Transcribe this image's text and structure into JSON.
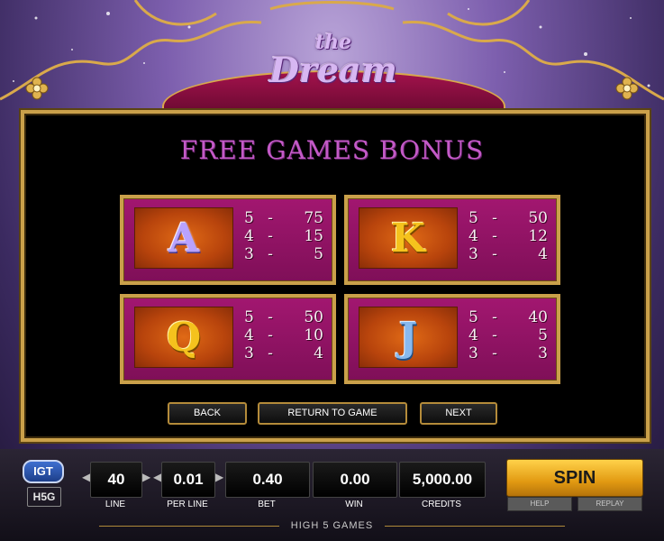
{
  "game": {
    "logo_small": "the",
    "logo_main": "Dream"
  },
  "bonus": {
    "title": "FREE GAMES BONUS",
    "symbols": [
      {
        "letter": "A",
        "color": "purple",
        "pays": [
          {
            "count": "5",
            "amount": "75"
          },
          {
            "count": "4",
            "amount": "15"
          },
          {
            "count": "3",
            "amount": "5"
          }
        ]
      },
      {
        "letter": "K",
        "color": "gold",
        "pays": [
          {
            "count": "5",
            "amount": "50"
          },
          {
            "count": "4",
            "amount": "12"
          },
          {
            "count": "3",
            "amount": "4"
          }
        ]
      },
      {
        "letter": "Q",
        "color": "gold",
        "pays": [
          {
            "count": "5",
            "amount": "50"
          },
          {
            "count": "4",
            "amount": "10"
          },
          {
            "count": "3",
            "amount": "4"
          }
        ]
      },
      {
        "letter": "J",
        "color": "blue",
        "pays": [
          {
            "count": "5",
            "amount": "40"
          },
          {
            "count": "4",
            "amount": "5"
          },
          {
            "count": "3",
            "amount": "3"
          }
        ]
      }
    ],
    "dash": "-"
  },
  "nav": {
    "back": "BACK",
    "return": "RETURN TO GAME",
    "next": "NEXT"
  },
  "meters": {
    "line": {
      "value": "40",
      "label": "LINE"
    },
    "per_line": {
      "value": "0.01",
      "label": "PER LINE"
    },
    "bet": {
      "value": "0.40",
      "label": "BET"
    },
    "win": {
      "value": "0.00",
      "label": "WIN"
    },
    "credits": {
      "value": "5,000.00",
      "label": "CREDITS"
    }
  },
  "controls": {
    "spin": "SPIN",
    "help": "HELP",
    "replay": "REPLAY"
  },
  "branding": {
    "igt": "IGT",
    "h5g": "H5G",
    "footer": "HIGH 5 GAMES"
  },
  "colors": {
    "title": "#c35ac7",
    "frame_gold": "#caa04a",
    "panel_magenta": "#a21770",
    "spin_gold": "#ffd24a"
  },
  "icons": {
    "flower": "gold-flower-icon",
    "arrow_left": "left-arrow-icon",
    "arrow_right": "right-arrow-icon"
  }
}
